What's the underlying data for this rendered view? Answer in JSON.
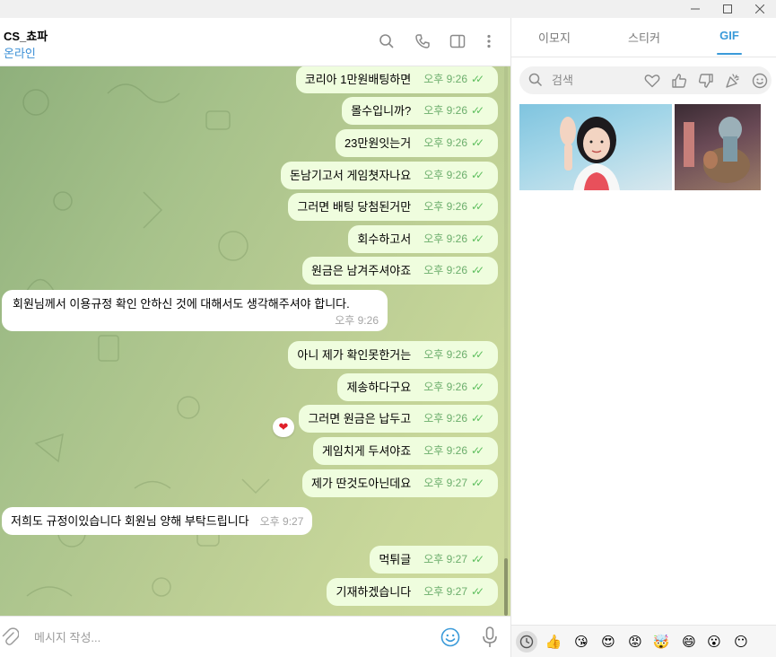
{
  "window": {
    "controls": [
      "minimize",
      "maximize",
      "close"
    ]
  },
  "header": {
    "title": "CS_쵸파",
    "status": "온라인",
    "icons": [
      "search-icon",
      "phone-icon",
      "sidebar-icon",
      "more-icon"
    ]
  },
  "messages": [
    {
      "dir": "out",
      "text": "코리아 1만원배팅하면",
      "time": "오후 9:26",
      "read": true
    },
    {
      "dir": "out",
      "text": "몰수입니까?",
      "time": "오후 9:26",
      "read": true
    },
    {
      "dir": "out",
      "text": "23만원잇는거",
      "time": "오후 9:26",
      "read": true
    },
    {
      "dir": "out",
      "text": "돈남기고서 게임쳣자나요",
      "time": "오후 9:26",
      "read": true
    },
    {
      "dir": "out",
      "text": "그러면 배팅 당첨된거만",
      "time": "오후 9:26",
      "read": true
    },
    {
      "dir": "out",
      "text": "회수하고서",
      "time": "오후 9:26",
      "read": true
    },
    {
      "dir": "out",
      "text": "원금은 남겨주셔야죠",
      "time": "오후 9:26",
      "read": true
    },
    {
      "dir": "in",
      "text": "회원님께서 이용규정 확인 안하신 것에 대해서도 생각해주셔야 합니다.",
      "time": "오후 9:26"
    },
    {
      "dir": "out",
      "text": "아니 제가 확인못한거는",
      "time": "오후 9:26",
      "read": true
    },
    {
      "dir": "out",
      "text": "제송하다구요",
      "time": "오후 9:26",
      "read": true
    },
    {
      "dir": "out",
      "text": "그러면 원금은 납두고",
      "time": "오후 9:26",
      "read": true,
      "reaction": "❤"
    },
    {
      "dir": "out",
      "text": "게임치게 두셔야죠",
      "time": "오후 9:26",
      "read": true
    },
    {
      "dir": "out",
      "text": "제가 딴것도아닌데요",
      "time": "오후 9:27",
      "read": true
    },
    {
      "dir": "in",
      "text": "저희도 규정이있습니다 회원님 양해 부탁드립니다",
      "time": "오후 9:27"
    },
    {
      "dir": "out",
      "text": "먹튀글",
      "time": "오후 9:27",
      "read": true
    },
    {
      "dir": "out",
      "text": "기재하겠습니다",
      "time": "오후 9:27",
      "read": true
    }
  ],
  "input": {
    "placeholder": "메시지 작성..."
  },
  "panel": {
    "tabs": [
      {
        "label": "이모지",
        "active": false
      },
      {
        "label": "스티커",
        "active": false
      },
      {
        "label": "GIF",
        "active": true
      }
    ],
    "search_placeholder": "검색",
    "categories": [
      "heart-icon",
      "thumbs-up-icon",
      "thumbs-down-icon",
      "party-icon",
      "smile-icon"
    ],
    "gifs": [
      "gif-woman-waving",
      "gif-cartoon-characters"
    ],
    "emoji_bar": [
      "🕒",
      "👍",
      "😘",
      "😍",
      "😡",
      "🤯",
      "😄",
      "😮",
      "😶"
    ]
  },
  "colors": {
    "accent": "#3a9ad9",
    "outgoing_bubble": "#effdde",
    "incoming_bubble": "#ffffff",
    "read_check": "#5fbf5f",
    "status_online": "#3a8fd6"
  }
}
